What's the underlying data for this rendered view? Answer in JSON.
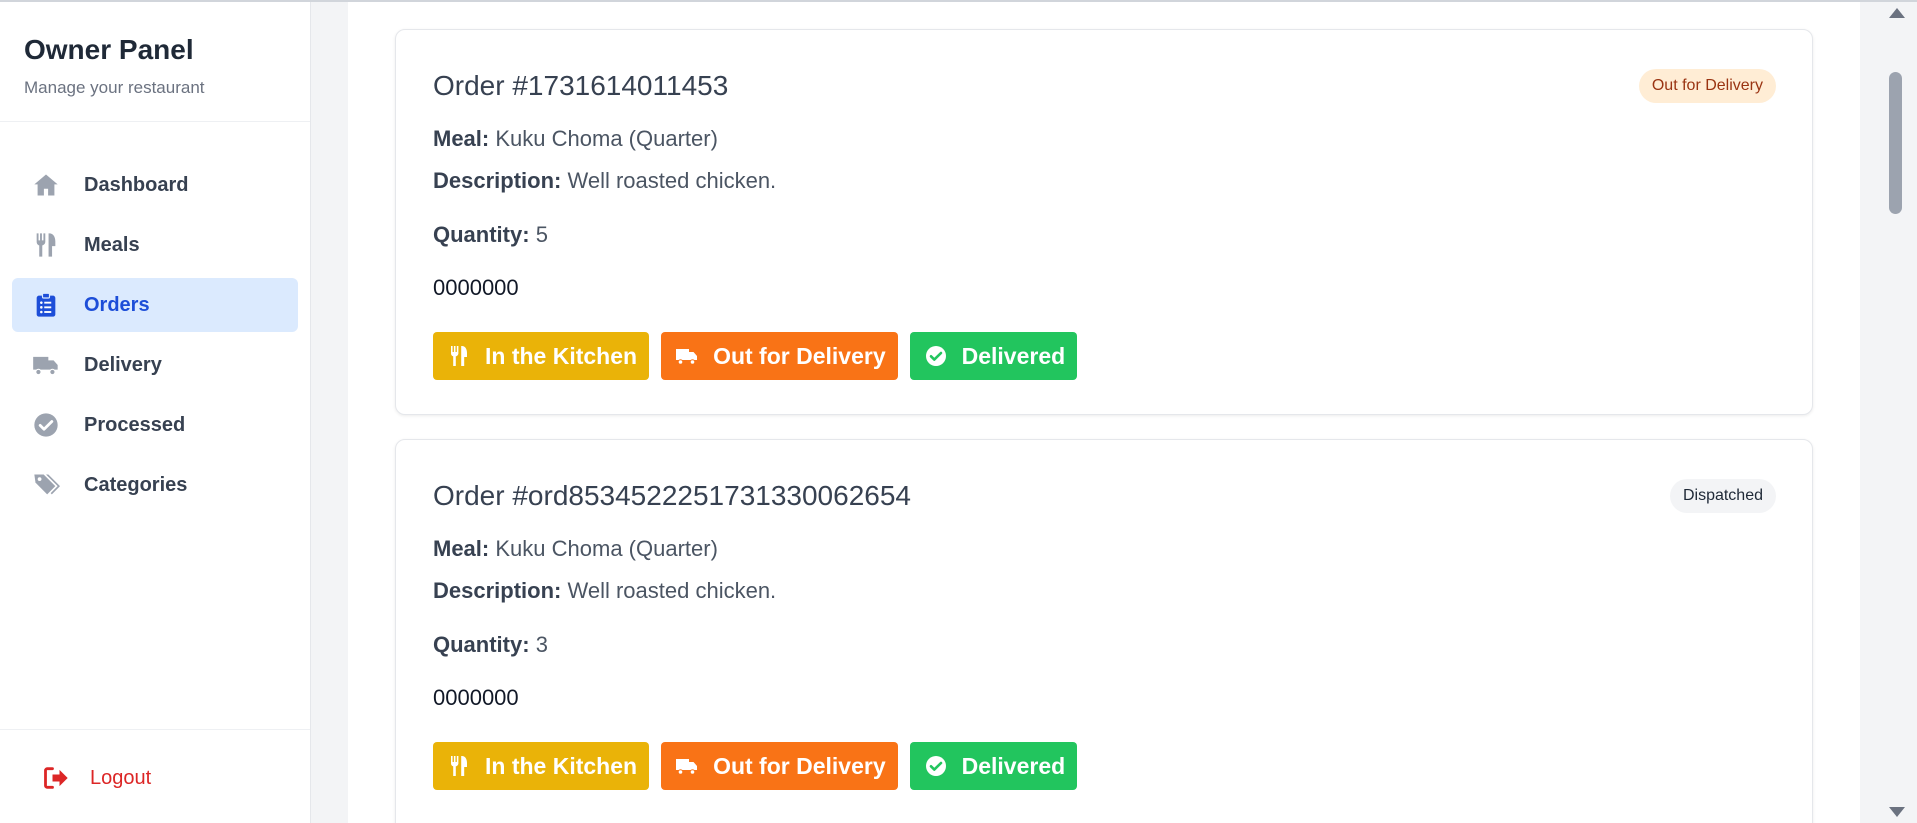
{
  "sidebar": {
    "title": "Owner Panel",
    "subtitle": "Manage your restaurant",
    "items": [
      {
        "label": "Dashboard",
        "icon": "home-icon"
      },
      {
        "label": "Meals",
        "icon": "utensils-icon"
      },
      {
        "label": "Orders",
        "icon": "clipboard-list-icon",
        "active": true
      },
      {
        "label": "Delivery",
        "icon": "truck-icon"
      },
      {
        "label": "Processed",
        "icon": "check-circle-icon"
      },
      {
        "label": "Categories",
        "icon": "tags-icon"
      }
    ],
    "logout_label": "Logout"
  },
  "labels": {
    "meal": "Meal:",
    "description": "Description:",
    "quantity": "Quantity:"
  },
  "buttons": {
    "kitchen": "In the Kitchen",
    "out_for_delivery": "Out for Delivery",
    "delivered": "Delivered"
  },
  "orders": [
    {
      "title": "Order #1731614011453",
      "status": "Out for Delivery",
      "meal": "Kuku Choma (Quarter)",
      "description": "Well roasted chicken.",
      "quantity": "5",
      "phone": "0000000"
    },
    {
      "title": "Order #ord8534522251731330062654",
      "status": "Dispatched",
      "meal": "Kuku Choma (Quarter)",
      "description": "Well roasted chicken.",
      "quantity": "3",
      "phone": "0000000"
    }
  ],
  "colors": {
    "active_bg": "#dbeafe",
    "active_text": "#1d4ed8",
    "kitchen": "#eab308",
    "out_for_delivery": "#f97316",
    "delivered": "#22c55e",
    "logout": "#dc2626"
  }
}
